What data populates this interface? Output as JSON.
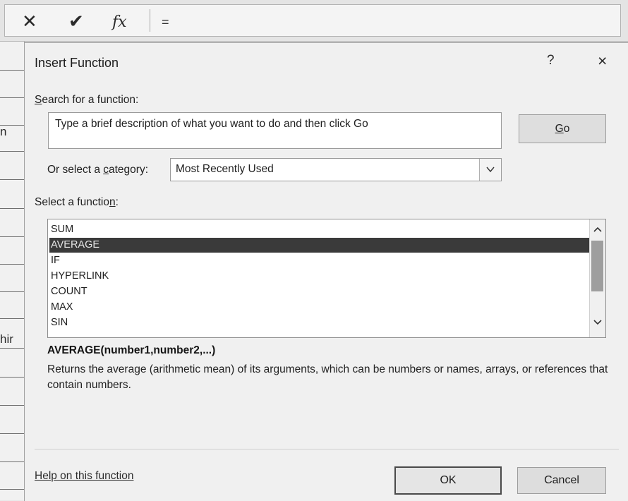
{
  "formula_bar": {
    "cancel_icon": "close-x-icon",
    "enter_icon": "checkmark-icon",
    "fx_label": "fx",
    "value": "="
  },
  "sheet": {
    "cell_fragments": [
      "n",
      "hir"
    ]
  },
  "dialog": {
    "title": "Insert Function",
    "help_label": "?",
    "close_label": "×",
    "search_label_accesskey": "S",
    "search_label_rest": "earch for a function:",
    "search_placeholder": "Type a brief description of what you want to do and then click Go",
    "go_accesskey": "G",
    "go_rest": "o",
    "category_label_pre": "Or select a ",
    "category_label_accesskey": "c",
    "category_label_post": "ategory:",
    "category_value": "Most Recently Used",
    "function_label_pre": "Select a functio",
    "function_label_accesskey": "n",
    "function_label_post": ":",
    "functions": [
      "SUM",
      "AVERAGE",
      "IF",
      "HYPERLINK",
      "COUNT",
      "MAX",
      "SIN"
    ],
    "selected_function": "AVERAGE",
    "signature": "AVERAGE(number1,number2,...)",
    "description": "Returns the average (arithmetic mean) of its arguments, which can be numbers or names, arrays, or references that contain numbers.",
    "help_link": "Help on this function",
    "ok_label": "OK",
    "cancel_label": "Cancel"
  },
  "colors": {
    "dialog_bg": "#f0f0f0",
    "selected_row_bg": "#3a3a3a",
    "selected_row_text": "#e6e6e6"
  }
}
